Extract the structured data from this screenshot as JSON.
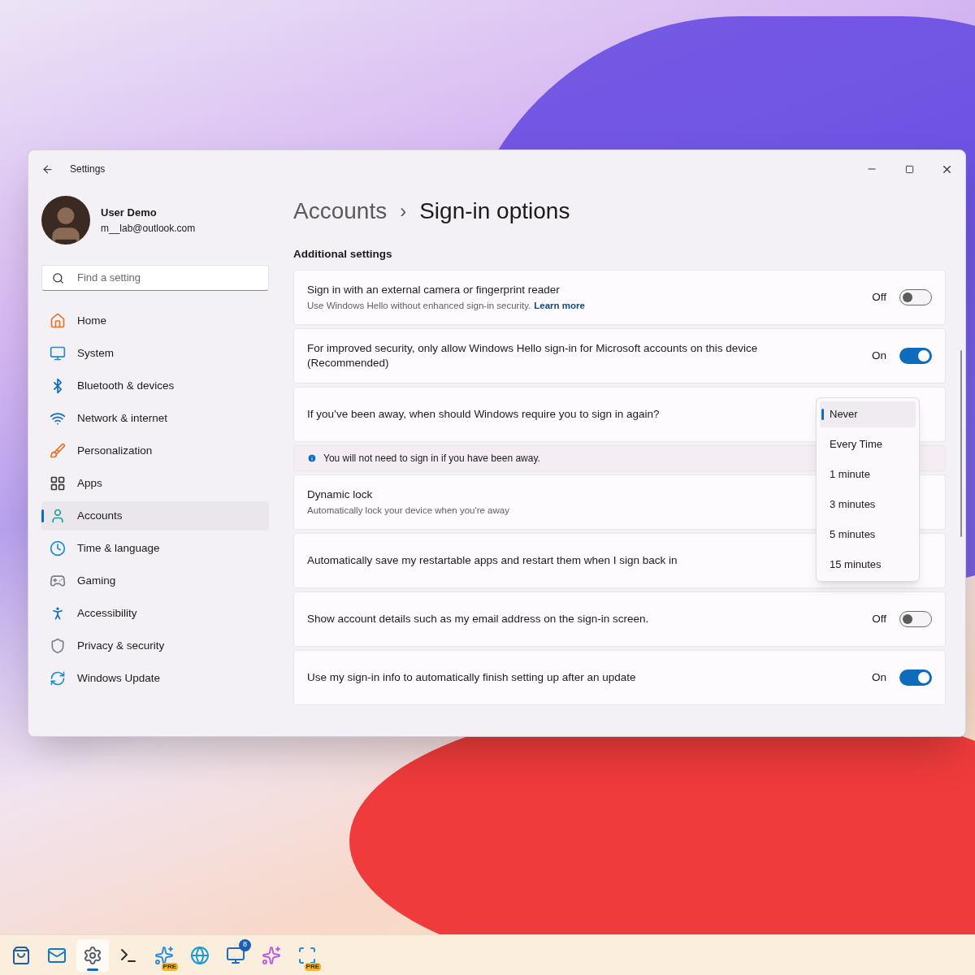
{
  "window": {
    "title": "Settings"
  },
  "user": {
    "name": "User Demo",
    "email": "m__lab@outlook.com"
  },
  "search": {
    "placeholder": "Find a setting"
  },
  "sidebar": {
    "items": [
      {
        "label": "Home",
        "selected": false
      },
      {
        "label": "System",
        "selected": false
      },
      {
        "label": "Bluetooth & devices",
        "selected": false
      },
      {
        "label": "Network & internet",
        "selected": false
      },
      {
        "label": "Personalization",
        "selected": false
      },
      {
        "label": "Apps",
        "selected": false
      },
      {
        "label": "Accounts",
        "selected": true
      },
      {
        "label": "Time & language",
        "selected": false
      },
      {
        "label": "Gaming",
        "selected": false
      },
      {
        "label": "Accessibility",
        "selected": false
      },
      {
        "label": "Privacy & security",
        "selected": false
      },
      {
        "label": "Windows Update",
        "selected": false
      }
    ]
  },
  "breadcrumb": {
    "parent": "Accounts",
    "separator": "›",
    "current": "Sign-in options"
  },
  "section_title": "Additional settings",
  "settings": [
    {
      "kind": "toggle",
      "title": "Sign in with an external camera or fingerprint reader",
      "description": "Use Windows Hello without enhanced sign-in security.",
      "link": "Learn more",
      "on": false,
      "state": "Off"
    },
    {
      "kind": "toggle",
      "title": "For improved security, only allow Windows Hello sign-in for Microsoft accounts on this device (Recommended)",
      "on": true,
      "state": "On"
    },
    {
      "kind": "dropdown",
      "title": "If you’ve been away, when should Windows require you to sign in again?"
    },
    {
      "kind": "info",
      "title": "You will not need to sign in if you have been away."
    },
    {
      "kind": "plain",
      "title": "Dynamic lock",
      "description": "Automatically lock your device when you're away"
    },
    {
      "kind": "plain",
      "title": "Automatically save my restartable apps and restart them when I sign back in"
    },
    {
      "kind": "toggle",
      "title": "Show account details such as my email address on the sign-in screen.",
      "on": false,
      "state": "Off"
    },
    {
      "kind": "toggle",
      "title": "Use my sign-in info to automatically finish setting up after an update",
      "on": true,
      "state": "On"
    }
  ],
  "dropdown_menu": {
    "options": [
      {
        "label": "Never",
        "selected": true
      },
      {
        "label": "Every Time",
        "selected": false
      },
      {
        "label": "1 minute",
        "selected": false
      },
      {
        "label": "3 minutes",
        "selected": false
      },
      {
        "label": "5 minutes",
        "selected": false
      },
      {
        "label": "15 minutes",
        "selected": false
      }
    ]
  },
  "taskbar": {
    "items": [
      {
        "selected": false
      },
      {
        "selected": false
      },
      {
        "selected": true
      },
      {
        "selected": false
      },
      {
        "selected": false,
        "badge": "PRE"
      },
      {
        "selected": false
      },
      {
        "selected": false,
        "count": "8"
      },
      {
        "selected": false
      },
      {
        "selected": false,
        "badge": "PRE"
      }
    ]
  }
}
